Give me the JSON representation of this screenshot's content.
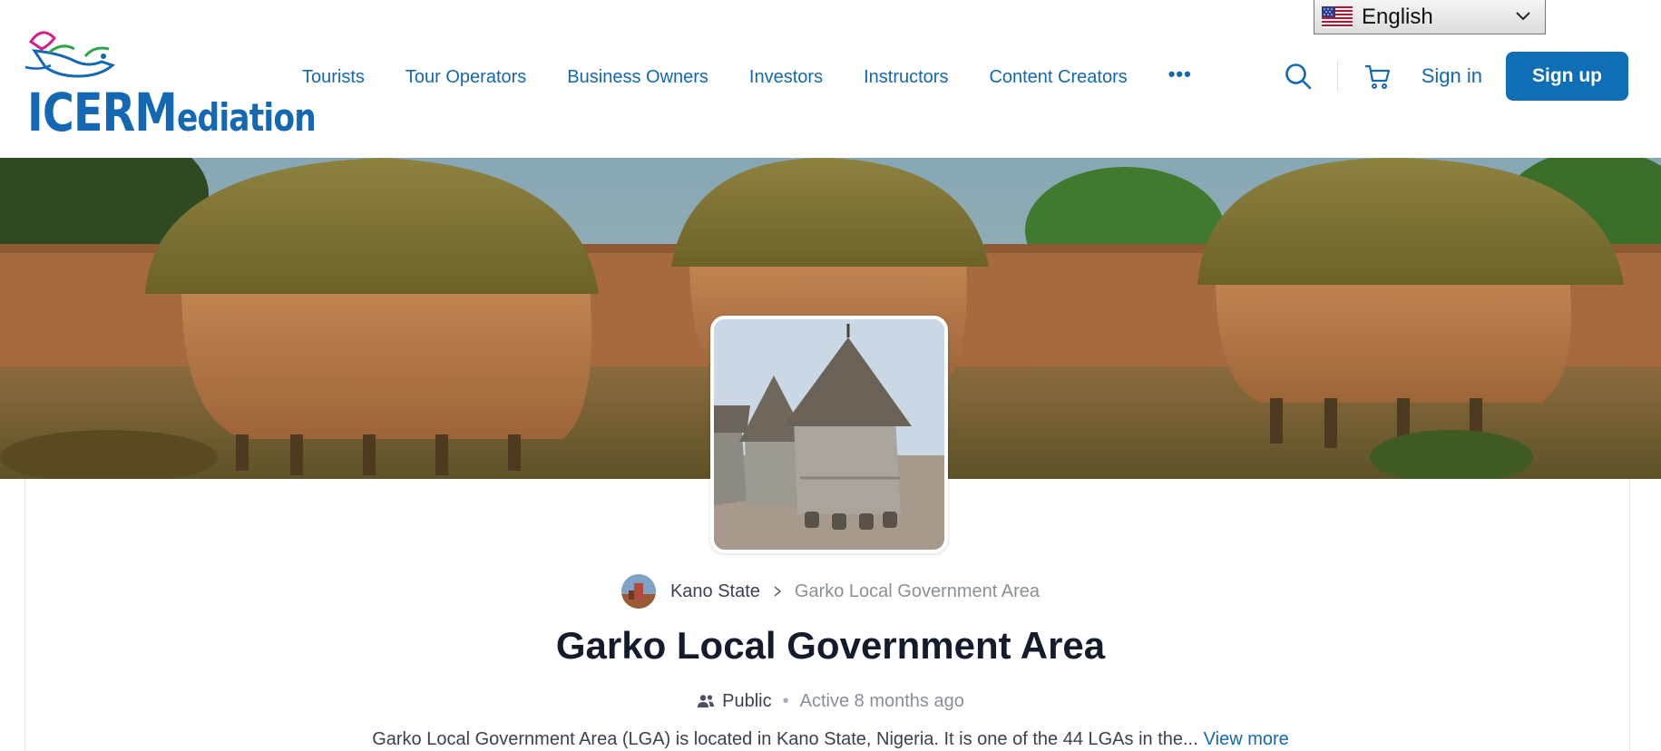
{
  "header": {
    "logo_text_big": "ICERM",
    "logo_text_small": "ediation",
    "nav_items": [
      "Tourists",
      "Tour Operators",
      "Business Owners",
      "Investors",
      "Instructors",
      "Content Creators"
    ],
    "more_label": "•••",
    "signin_label": "Sign in",
    "signup_label": "Sign up",
    "icons": [
      "search-icon",
      "cart-icon"
    ]
  },
  "language": {
    "selected": "English",
    "flag": "us-flag-icon"
  },
  "group": {
    "breadcrumb_parent": "Kano State",
    "breadcrumb_current": "Garko Local Government Area",
    "title": "Garko Local Government Area",
    "privacy": "Public",
    "activity": "Active 8 months ago",
    "description": "Garko Local Government Area (LGA) is located in Kano State, Nigeria. It is one of the 44 LGAs in the...",
    "view_more": "View more"
  },
  "colors": {
    "brand": "#1468b3",
    "signup_bg": "#0f6eb6",
    "title_text": "#141c2b"
  }
}
